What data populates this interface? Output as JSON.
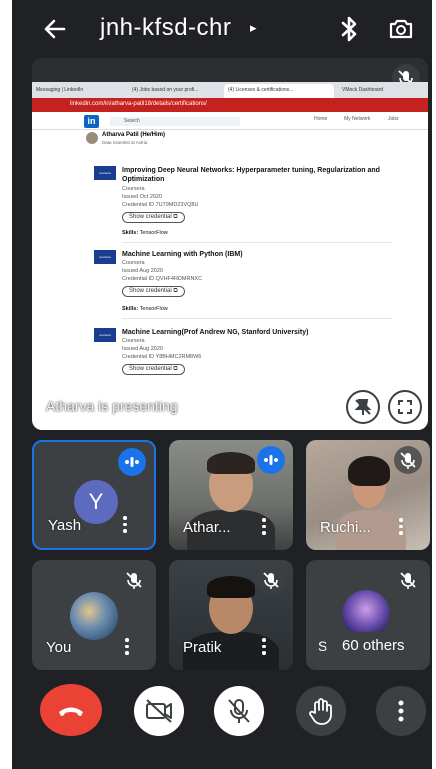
{
  "header": {
    "meeting_code": "jnh-kfsd-chr",
    "caret": "▸",
    "icons": [
      "back-arrow-icon",
      "bluetooth-icon",
      "switch-camera-icon"
    ]
  },
  "presentation": {
    "tabs": [
      "Messaging | LinkedIn",
      "(4) Jobs based on your profi...",
      "(4) Licenses & certifications...",
      "VMock Dashboard"
    ],
    "url": "linkedin.com/in/atharva-patil18/details/certifications/",
    "search_placeholder": "Search",
    "nav": [
      "Home",
      "My Network",
      "Jobs"
    ],
    "profile_name": "Atharva Patil (He/Him)",
    "profile_role": "Data Scientist at Axtria",
    "logo_letters": "in",
    "coursera_label": "coursera",
    "show_credential": "Show credential ⧉",
    "skills_label": "Skills:",
    "certs": [
      {
        "title": "Improving Deep Neural Networks: Hyperparameter tuning, Regularization and Optimization",
        "issuer": "Coursera",
        "issued": "Issued Oct 2020",
        "credential": "Credential ID 7U79MD23VQ8U",
        "skills": "TensorFlow"
      },
      {
        "title": "Machine Learning with Python (IBM)",
        "issuer": "Coursera",
        "issued": "Issued Aug 2020",
        "credential": "Credential ID QVHF4RDMRNXC",
        "skills": "TensorFlow"
      },
      {
        "title": "Machine Learning(Prof Andrew NG, Stanford University)",
        "issuer": "Coursera",
        "issued": "Issued Aug 2020",
        "credential": "Credential ID Y8BHMC2RM8W6",
        "skills": ""
      }
    ],
    "presenting_label": "Atharva is presenting"
  },
  "participants": [
    {
      "name": "Yash",
      "initial": "Y",
      "status": "speaking"
    },
    {
      "name": "Athar...",
      "status": "speaking"
    },
    {
      "name": "Ruchi...",
      "status": "muted"
    },
    {
      "name": "You",
      "status": "muted"
    },
    {
      "name": "Pratik",
      "status": "muted"
    },
    {
      "name": "S",
      "status": "muted",
      "others_label": "60 others"
    }
  ],
  "controls": [
    "end-call",
    "camera-off",
    "mic-off",
    "raise-hand",
    "more-options"
  ],
  "colors": {
    "accent": "#1a73e8",
    "end_call": "#ea4335",
    "bg": "#202124",
    "tile": "#3c4043"
  }
}
